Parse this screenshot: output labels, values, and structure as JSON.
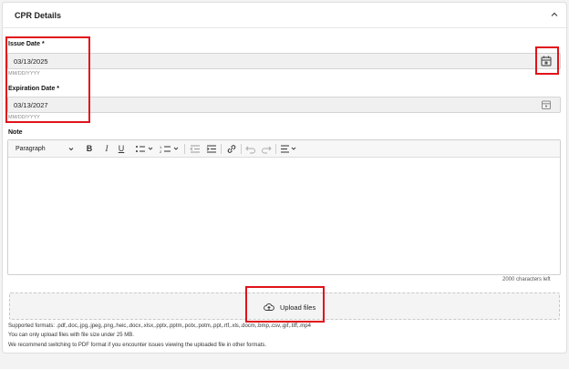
{
  "section": {
    "title": "CPR Details"
  },
  "issue_date": {
    "label": "Issue Date",
    "required_marks": " *",
    "value": "03/13/2025",
    "hint": "MM/DD/YYYY"
  },
  "expiration_date": {
    "label": "Expiration Date",
    "required_marks": " *",
    "value": "03/13/2027",
    "hint": "MM/DD/YYYY"
  },
  "note": {
    "label": "Note",
    "toolbar": {
      "paragraph_label": "Paragraph",
      "bold": "B",
      "italic": "I",
      "underline": "U"
    },
    "char_count": "2000 characters left"
  },
  "upload": {
    "button_label": "Upload files",
    "formats": "Supported formats: .pdf,.doc,.jpg,.jpeg,.png,.heic,.docx,.xlsx,.pptx,.pptm,.potx,.potm,.ppt,.rtf,.xls,.docm,.bmp,.csv,.gif,.tiff,.mp4",
    "size_limit": "You can only upload files with file size under 25 MB.",
    "recommendation": "We recommend switching to PDF format if you encounter issues viewing the uploaded file in other formats."
  },
  "colors": {
    "highlight": "#e0131a",
    "input_bg": "#f0f0f0"
  },
  "icons": [
    "chevron-up-icon",
    "calendar-icon",
    "chevron-down-icon",
    "bulleted-list-icon",
    "numbered-list-icon",
    "outdent-icon",
    "indent-icon",
    "link-icon",
    "undo-icon",
    "redo-icon",
    "align-icon",
    "cloud-upload-icon"
  ]
}
